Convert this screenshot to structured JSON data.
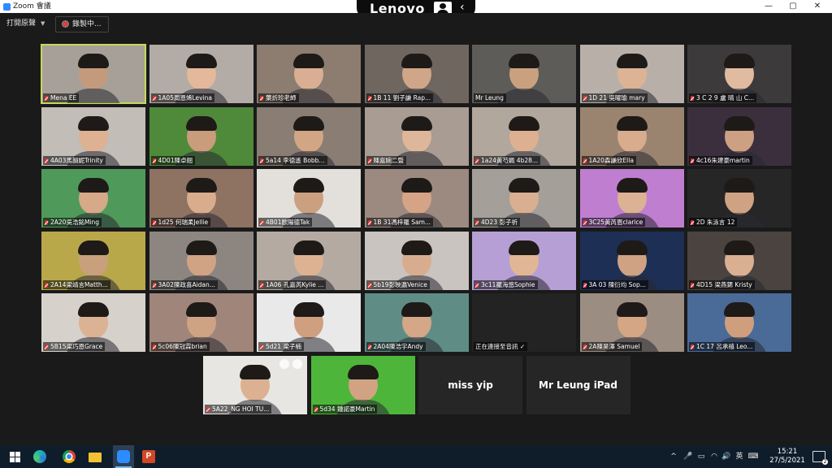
{
  "window": {
    "title": "Zoom 會議",
    "controls": [
      "—",
      "▢",
      "✕"
    ]
  },
  "lenovo_bar": {
    "brand": "Lenovo"
  },
  "toolbar": {
    "view_label": "打開原聲",
    "record_label": "錄製中..."
  },
  "participants": [
    {
      "name": "Mena EE",
      "active": true,
      "muted": true,
      "bg": "#a7a098",
      "face": "#c49a7c"
    },
    {
      "name": "1A05周恩烯Levina",
      "muted": true,
      "bg": "#b3aca6",
      "face": "#e4b89a"
    },
    {
      "name": "葉炘珍老師",
      "muted": true,
      "bg": "#8c7d70",
      "face": "#d9ae93"
    },
    {
      "name": "1B 11 劉子謙 Rap...",
      "muted": true,
      "bg": "#6f6660",
      "face": "#cfa688"
    },
    {
      "name": "Mr Leung",
      "muted": false,
      "bg": "#5e5c58",
      "face": "#caa17f"
    },
    {
      "name": "1D 21 吳曜瑜 mary",
      "muted": true,
      "bg": "#b8b0a8",
      "face": "#dcb394"
    },
    {
      "name": "3 C 2 9 盧 晴 山 C...",
      "muted": true,
      "bg": "#3d3a3c",
      "face": "#e0bba0"
    },
    {
      "name": "4A03馬韻妮Trinity",
      "muted": true,
      "bg": "#c2bdb6",
      "face": "#ddb192"
    },
    {
      "name": "4D01陳卓翹",
      "muted": true,
      "bg": "#4f8a3a",
      "face": "#c99c7c"
    },
    {
      "name": "5a14 李德遙 Bobb...",
      "muted": true,
      "bg": "#897d74",
      "face": "#d2a684"
    },
    {
      "name": "陳嘉婉二暨",
      "muted": true,
      "bg": "#a99c92",
      "face": "#deb699"
    },
    {
      "name": "1a24黃芍姵 4b28...",
      "muted": true,
      "bg": "#b1a79d",
      "face": "#dcb091"
    },
    {
      "name": "1A20森謙欣Ella",
      "muted": true,
      "bg": "#9a8470",
      "face": "#d9ac8e"
    },
    {
      "name": "4c16朱建豪martin",
      "muted": true,
      "bg": "#3b2f3d",
      "face": "#cda083"
    },
    {
      "name": "2A20吳浩銘Ming",
      "muted": true,
      "bg": "#4f9a5a",
      "face": "#d6a988"
    },
    {
      "name": "1d25 何瑞柔Jellie",
      "muted": true,
      "bg": "#8e7262",
      "face": "#d8ac8d"
    },
    {
      "name": "4B01歐陽德Tak",
      "muted": true,
      "bg": "#e3e0dc",
      "face": "#cba080"
    },
    {
      "name": "1B 31馮梓羅 Sam...",
      "muted": true,
      "bg": "#9c8a80",
      "face": "#d5a486"
    },
    {
      "name": "4D23 彭子祈",
      "muted": true,
      "bg": "#a59f9a",
      "face": "#d9af91"
    },
    {
      "name": "3C25黃芮恩clarice",
      "muted": true,
      "bg": "#c07ed0",
      "face": "#dcb294"
    },
    {
      "name": "2D 朱泳言 12",
      "muted": true,
      "bg": "#262626",
      "face": "#cfa283"
    },
    {
      "name": "2A14梁靖言Matth...",
      "muted": true,
      "bg": "#b9a84a",
      "face": "#c8a07c"
    },
    {
      "name": "3A02陳政喜Aidan...",
      "muted": true,
      "bg": "#8d8680",
      "face": "#cfa384"
    },
    {
      "name": "1A06 孔嘉芮Kylie ...",
      "muted": true,
      "bg": "#b4aaa2",
      "face": "#ddb293"
    },
    {
      "name": "5b19彭映瀛Venice",
      "muted": true,
      "bg": "#c9c4bf",
      "face": "#d8ad8f"
    },
    {
      "name": "3c11羅海悠Sophie",
      "muted": true,
      "bg": "#b69fd4",
      "face": "#e0b697"
    },
    {
      "name": "3A 03 陳衍均 Sop...",
      "muted": true,
      "bg": "#1e2f55",
      "face": "#cea283"
    },
    {
      "name": "4D15 梁燕鍶 Kristy",
      "muted": true,
      "bg": "#4a4340",
      "face": "#dab092"
    },
    {
      "name": "5B15梁巧恩Grace",
      "muted": true,
      "bg": "#d6d1cb",
      "face": "#dcb294"
    },
    {
      "name": "5c06陳冠霖brian",
      "muted": true,
      "bg": "#a0857a",
      "face": "#cea384"
    },
    {
      "name": "5d21 梁子楠",
      "muted": true,
      "bg": "#e9e9e9",
      "face": "#cf9f80"
    },
    {
      "name": "2A04陳浩宇Andy",
      "muted": true,
      "bg": "#5f8d86",
      "face": "#d3a787"
    },
    {
      "name": "正在連接至音訊 ✓",
      "muted": false,
      "connecting": true,
      "bg": "#232323",
      "face": ""
    },
    {
      "name": "2A陳昊澤 Samuel",
      "muted": true,
      "bg": "#9b8d82",
      "face": "#d4a685"
    },
    {
      "name": "1C 17 呂承禧 Leo...",
      "muted": true,
      "bg": "#4a6a98",
      "face": "#cf9f7d"
    },
    {
      "name": "5A22_NG HOI TU...",
      "muted": true,
      "bg": "#e8e6e3",
      "face": "#dcb192"
    },
    {
      "name": "5d34 鍾諾豪Martin",
      "muted": true,
      "bg": "#4db53a",
      "face": "#d1a383"
    },
    {
      "name": "miss yip",
      "name_only": true
    },
    {
      "name": "Mr Leung iPad",
      "name_only": true
    }
  ],
  "taskbar": {
    "apps": [
      "start-icon",
      "edge-icon",
      "chrome-icon",
      "folder-icon",
      "zoom-icon",
      "powerpoint-icon"
    ],
    "tray": {
      "chevron": "^",
      "ime": "英",
      "time": "15:21",
      "date": "27/5/2021",
      "notifications": "2"
    }
  }
}
